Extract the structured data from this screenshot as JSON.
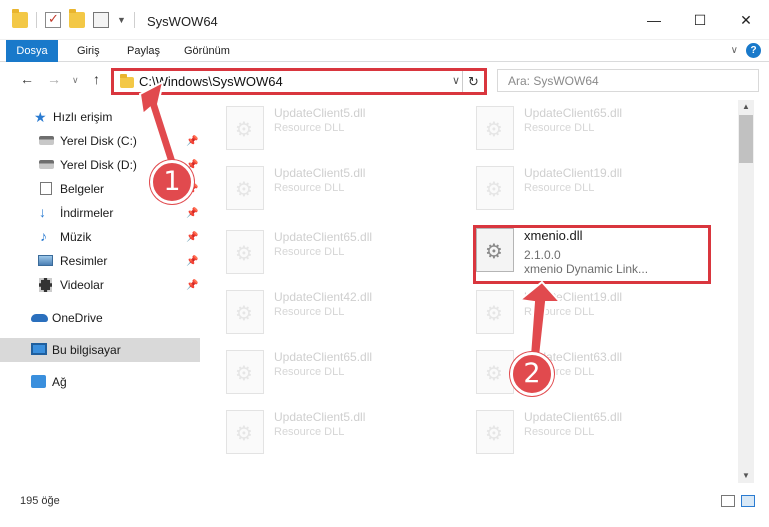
{
  "window": {
    "title": "SysWOW64",
    "controls": {
      "minimize": "—",
      "maximize": "☐",
      "close": "✕"
    }
  },
  "ribbon": {
    "tabs": [
      "Dosya",
      "Giriş",
      "Paylaş",
      "Görünüm"
    ],
    "expand": "∨",
    "help": "?"
  },
  "nav": {
    "back": "←",
    "forward": "→",
    "recent": "∨",
    "up": "↑",
    "address": "C:\\Windows\\SysWOW64",
    "dropdown": "∨",
    "refresh": "↻",
    "search_placeholder": "Ara: SysWOW64"
  },
  "sidebar": {
    "items": [
      {
        "label": "Hızlı erişim",
        "icon": "star-icon"
      },
      {
        "label": "Yerel Disk (C:)",
        "icon": "disk-icon",
        "pinned": true
      },
      {
        "label": "Yerel Disk (D:)",
        "icon": "disk-icon",
        "pinned": true
      },
      {
        "label": "Belgeler",
        "icon": "documents-icon",
        "pinned": true
      },
      {
        "label": "İndirmeler",
        "icon": "downloads-icon",
        "pinned": true
      },
      {
        "label": "Müzik",
        "icon": "music-icon",
        "pinned": true
      },
      {
        "label": "Resimler",
        "icon": "pictures-icon",
        "pinned": true
      },
      {
        "label": "Videolar",
        "icon": "videos-icon",
        "pinned": true
      },
      {
        "label": "OneDrive",
        "icon": "onedrive-icon"
      },
      {
        "label": "Bu bilgisayar",
        "icon": "computer-icon",
        "selected": true
      },
      {
        "label": "Ağ",
        "icon": "network-icon"
      }
    ],
    "pin_glyph": "📌"
  },
  "files": {
    "left": [
      {
        "name": "UpdateClient5.dll",
        "type": "Resource DLL"
      },
      {
        "name": "UpdateClient5.dll",
        "type": "Resource DLL"
      },
      {
        "name": "UpdateClient65.dll",
        "type": "Resource DLL"
      },
      {
        "name": "UpdateClient42.dll",
        "type": "Resource DLL"
      },
      {
        "name": "UpdateClient65.dll",
        "type": "Resource DLL"
      },
      {
        "name": "UpdateClient5.dll",
        "type": "Resource DLL"
      }
    ],
    "right": [
      {
        "name": "UpdateClient65.dll",
        "type": "Resource DLL"
      },
      {
        "name": "UpdateClient19.dll",
        "type": "Resource DLL"
      },
      {
        "name": "UpdateClient19.dll",
        "type": "Resource DLL"
      },
      {
        "name": "UpdateClient63.dll",
        "type": "Resource DLL"
      },
      {
        "name": "UpdateClient65.dll",
        "type": "Resource DLL"
      }
    ],
    "highlighted": {
      "name": "xmenio.dll",
      "version": "2.1.0.0",
      "description": "xmenio Dynamic Link..."
    }
  },
  "status": {
    "item_count": "195 öğe"
  },
  "annotations": {
    "step1": "1",
    "step2": "2",
    "color": "#e14a4e"
  }
}
